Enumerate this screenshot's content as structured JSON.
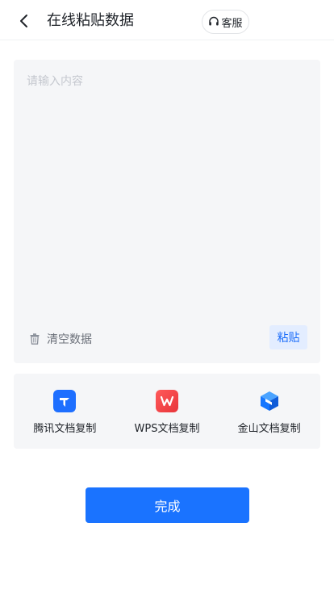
{
  "header": {
    "title": "在线粘贴数据",
    "service_label": "客服"
  },
  "editor": {
    "placeholder": "请输入内容",
    "value": "",
    "clear_label": "清空数据",
    "paste_label": "粘贴"
  },
  "sources": [
    {
      "label": "腾讯文档复制",
      "icon": "tencent-docs-icon",
      "color": "#1e6fff"
    },
    {
      "label": "WPS文档复制",
      "icon": "wps-icon",
      "color": "#fa3d3d"
    },
    {
      "label": "金山文档复制",
      "icon": "kingsoft-docs-icon",
      "color": "#1677ff"
    }
  ],
  "actions": {
    "done_label": "完成"
  },
  "colors": {
    "primary": "#1a73ff",
    "panel_bg": "#f5f6f8",
    "paste_bg": "#e3edff"
  }
}
